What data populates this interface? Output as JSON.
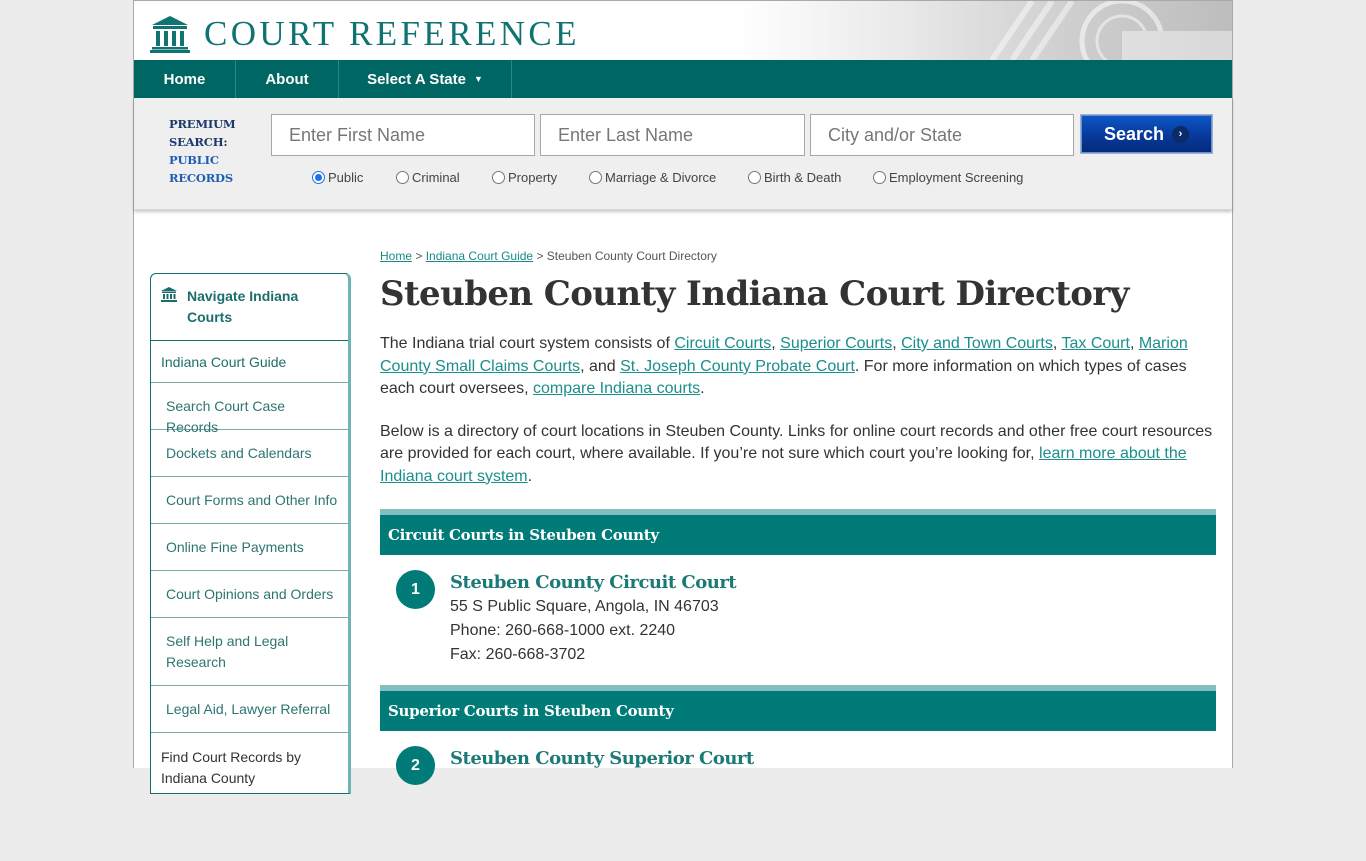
{
  "brand": {
    "name": "COURT REFERENCE"
  },
  "nav": {
    "home": "Home",
    "about": "About",
    "select_state": "Select A State",
    "caret": "▼"
  },
  "search": {
    "label_line1": "PREMIUM",
    "label_line2": "SEARCH:",
    "label_line3": "PUBLIC",
    "label_line4": "RECORDS",
    "first_name_placeholder": "Enter First Name",
    "last_name_placeholder": "Enter Last Name",
    "city_state_placeholder": "City and/or State",
    "button_label": "Search",
    "button_icon": "›",
    "options": [
      {
        "label": "Public",
        "selected": true
      },
      {
        "label": "Criminal",
        "selected": false
      },
      {
        "label": "Property",
        "selected": false
      },
      {
        "label": "Marriage & Divorce",
        "selected": false
      },
      {
        "label": "Birth & Death",
        "selected": false
      },
      {
        "label": "Employment Screening",
        "selected": false
      }
    ]
  },
  "sidebar": {
    "title": "Navigate Indiana Courts",
    "items": [
      {
        "label": "Indiana Court Guide"
      },
      {
        "label": "Search Court Case Records"
      },
      {
        "label": "Dockets and Calendars"
      },
      {
        "label": "Court Forms and Other Info"
      },
      {
        "label": "Online Fine Payments"
      },
      {
        "label": "Court Opinions and Orders"
      },
      {
        "label": "Self Help and Legal Research"
      },
      {
        "label": "Legal Aid, Lawyer Referral"
      },
      {
        "label": "Find Court Records by Indiana County"
      }
    ]
  },
  "breadcrumb": {
    "home": "Home",
    "sep": " > ",
    "guide": "Indiana Court Guide",
    "current": "Steuben County Court Directory"
  },
  "page_title": "Steuben County Indiana Court Directory",
  "intro": {
    "t1": "The Indiana trial court system consists of ",
    "l1": "Circuit Courts",
    "c1": ", ",
    "l2": "Superior Courts",
    "c2": ", ",
    "l3": "City and Town Courts",
    "c3": ", ",
    "l4": "Tax Court",
    "c4": ", ",
    "l5": "Marion County Small Claims Courts",
    "c5": ", and ",
    "l6": "St. Joseph County Probate Court",
    "t2": ". For more information on which types of cases each court oversees, ",
    "l7": "compare Indiana courts",
    "t3": "."
  },
  "directory_intro": {
    "t1": "Below is a directory of court locations in Steuben County. Links for online court records and other free court resources are provided for each court, where available. If you’re not sure which court you’re looking for, ",
    "link": "learn more about the Indiana court system",
    "t2": "."
  },
  "sections": [
    {
      "heading": "Circuit Courts in Steuben County",
      "courts": [
        {
          "number": "1",
          "name": "Steuben County Circuit Court",
          "address": "55 S Public Square, Angola, IN 46703",
          "phone": "Phone: 260-668-1000 ext. 2240",
          "fax": "Fax: 260-668-3702"
        }
      ]
    },
    {
      "heading": "Superior Courts in Steuben County",
      "courts": [
        {
          "number": "2",
          "name": "Steuben County Superior Court"
        }
      ]
    }
  ],
  "colors": {
    "brand_teal": "#006663",
    "section_teal": "#007b78",
    "link_teal": "#1a8f8b",
    "search_blue": "#07399a"
  }
}
